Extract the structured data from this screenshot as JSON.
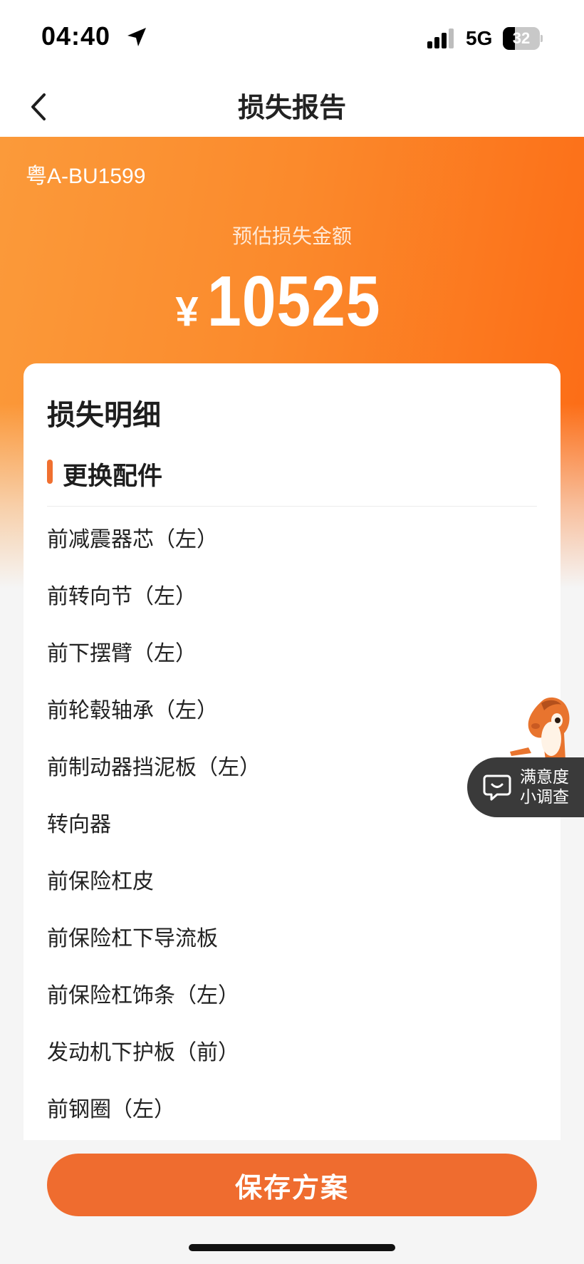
{
  "status_bar": {
    "time": "04:40",
    "network": "5G",
    "battery_level": "32",
    "battery_fraction": 0.32,
    "icons": [
      "location-arrow-icon",
      "signal-bars-icon",
      "battery-icon"
    ]
  },
  "nav": {
    "back_icon": "chevron-left-icon",
    "title": "损失报告"
  },
  "hero": {
    "plate_number": "粤A-BU1599",
    "amount_caption": "预估损失金额",
    "currency_symbol": "¥",
    "amount": "10525"
  },
  "details": {
    "title": "损失明细",
    "section_title": "更换配件",
    "parts": [
      "前减震器芯（左）",
      "前转向节（左）",
      "前下摆臂（左）",
      "前轮毂轴承（左）",
      "前制动器挡泥板（左）",
      "转向器",
      "前保险杠皮",
      "前保险杠下导流板",
      "前保险杠饰条（左）",
      "发动机下护板（前）",
      "前钢圈（左）"
    ]
  },
  "survey": {
    "line1": "满意度",
    "line2": "小调查",
    "icon": "chat-bubble-icon",
    "mascot": "horse-mascot-icon"
  },
  "footer": {
    "save_label": "保存方案"
  },
  "colors": {
    "accent": "#ef6c2f",
    "hero_start": "#fb9a3a",
    "hero_end": "#fc6a14",
    "survey_bg": "#3a3a3a"
  }
}
